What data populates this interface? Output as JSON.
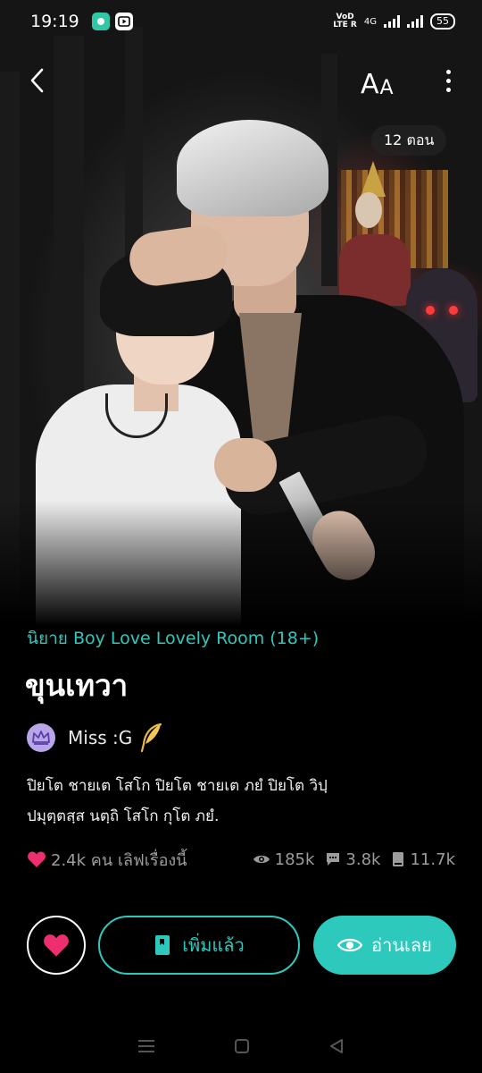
{
  "status_bar": {
    "time": "19:19",
    "volte_top": "VoD",
    "volte_bottom": "LTE R",
    "network": "4G",
    "battery": "55"
  },
  "cover": {
    "episodes": "12 ตอน",
    "font_size_big": "A",
    "font_size_small": "A"
  },
  "novel": {
    "category": "นิยาย Boy Love Lovely Room  (18+)",
    "title": "ขุนเทวา",
    "author": "Miss :G",
    "description_line1": "ปิยโต ชายเต โสโก  ปิยโต ชายเต ภยํ  ปิยโต วิปฺ",
    "description_line2": "ปมุตฺตสฺส นตฺถิ โสโก กุโต ภยํ."
  },
  "stats": {
    "likes": "2.4k คน เลิฟเรื่องนี้",
    "views": "185k",
    "comments": "3.8k",
    "bookmarks": "11.7k"
  },
  "actions": {
    "added_label": "เพิ่มแล้ว",
    "read_label": "อ่านเลย"
  },
  "colors": {
    "accent": "#2ec9bd",
    "heart": "#ee2f6d",
    "muted": "#9c9c9c",
    "background": "#000000"
  },
  "icons": [
    "back-chevron-icon",
    "font-size-icon",
    "more-vertical-icon",
    "heart-icon",
    "eye-icon",
    "comment-icon",
    "book-icon",
    "feather-icon",
    "crown-icon"
  ]
}
